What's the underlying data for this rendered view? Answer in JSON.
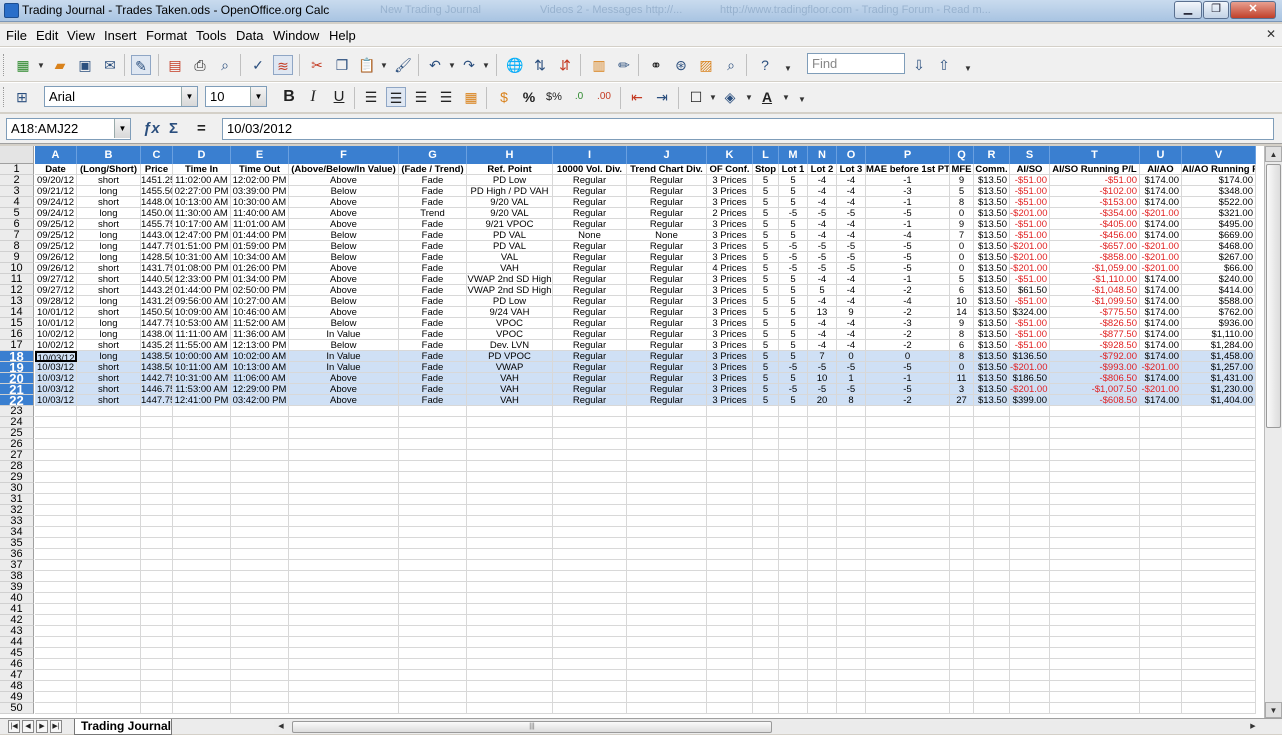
{
  "window": {
    "title": "Trading Journal - Trades Taken.ods - OpenOffice.org Calc",
    "background_ghost_text": [
      "New Trading Journal",
      "Videos 2 - Messages http://...",
      "http://www.tradingfloor.com - Trading Forum - Read m..."
    ]
  },
  "menu": [
    "File",
    "Edit",
    "View",
    "Insert",
    "Format",
    "Tools",
    "Data",
    "Window",
    "Help"
  ],
  "toolbar": {
    "find_placeholder": "Find",
    "font_name": "Arial",
    "font_size": "10"
  },
  "formula_bar": {
    "name_box": "A18:AMJ22",
    "fx_icon": "function-wizard-icon",
    "sum_icon": "sigma-icon",
    "equals": "=",
    "content": "10/03/2012"
  },
  "columns": [
    "A",
    "B",
    "C",
    "D",
    "E",
    "F",
    "G",
    "H",
    "I",
    "J",
    "K",
    "L",
    "M",
    "N",
    "O",
    "P",
    "Q",
    "R",
    "S",
    "T",
    "U",
    "V"
  ],
  "headers": [
    "Date",
    "(Long/Short)",
    "Price",
    "Time In",
    "Time Out",
    "(Above/Below/In Value)",
    "(Fade / Trend)",
    "Ref. Point",
    "10000 Vol. Div.",
    "Trend Chart Div.",
    "OF Conf.",
    "Stop",
    "Lot 1",
    "Lot 2",
    "Lot 3",
    "MAE before 1st PT",
    "MFE",
    "Comm.",
    "AI/SO",
    "AI/SO Running P/L",
    "AI/AO",
    "AI/AO Running P/L"
  ],
  "rows": [
    [
      "09/20/12",
      "short",
      "1451.25",
      "11:02:00 AM",
      "12:02:00 PM",
      "Above",
      "Fade",
      "PD Low",
      "Regular",
      "Regular",
      "3 Prices",
      "5",
      "5",
      "-4",
      "-4",
      "-1",
      "9",
      "$13.50",
      "-$51.00",
      "-$51.00",
      "$174.00",
      "$174.00"
    ],
    [
      "09/21/12",
      "long",
      "1455.50",
      "02:27:00 PM",
      "03:39:00 PM",
      "Below",
      "Fade",
      "PD High / PD VAH",
      "Regular",
      "Regular",
      "3 Prices",
      "5",
      "5",
      "-4",
      "-4",
      "-3",
      "5",
      "$13.50",
      "-$51.00",
      "-$102.00",
      "$174.00",
      "$348.00"
    ],
    [
      "09/24/12",
      "short",
      "1448.00",
      "10:13:00 AM",
      "10:30:00 AM",
      "Above",
      "Fade",
      "9/20 VAL",
      "Regular",
      "Regular",
      "3 Prices",
      "5",
      "5",
      "-4",
      "-4",
      "-1",
      "8",
      "$13.50",
      "-$51.00",
      "-$153.00",
      "$174.00",
      "$522.00"
    ],
    [
      "09/24/12",
      "long",
      "1450.00",
      "11:30:00 AM",
      "11:40:00 AM",
      "Above",
      "Trend",
      "9/20 VAL",
      "Regular",
      "Regular",
      "2 Prices",
      "5",
      "-5",
      "-5",
      "-5",
      "-5",
      "0",
      "$13.50",
      "-$201.00",
      "-$354.00",
      "-$201.00",
      "$321.00"
    ],
    [
      "09/25/12",
      "short",
      "1455.75",
      "10:17:00 AM",
      "11:01:00 AM",
      "Above",
      "Fade",
      "9/21 VPOC",
      "Regular",
      "Regular",
      "3 Prices",
      "5",
      "5",
      "-4",
      "-4",
      "-1",
      "9",
      "$13.50",
      "-$51.00",
      "-$405.00",
      "$174.00",
      "$495.00"
    ],
    [
      "09/25/12",
      "long",
      "1443.00",
      "12:47:00 PM",
      "01:44:00 PM",
      "Below",
      "Fade",
      "PD VAL",
      "None",
      "None",
      "3 Prices",
      "5",
      "5",
      "-4",
      "-4",
      "-4",
      "7",
      "$13.50",
      "-$51.00",
      "-$456.00",
      "$174.00",
      "$669.00"
    ],
    [
      "09/25/12",
      "long",
      "1447.75",
      "01:51:00 PM",
      "01:59:00 PM",
      "Below",
      "Fade",
      "PD VAL",
      "Regular",
      "Regular",
      "3 Prices",
      "5",
      "-5",
      "-5",
      "-5",
      "-5",
      "0",
      "$13.50",
      "-$201.00",
      "-$657.00",
      "-$201.00",
      "$468.00"
    ],
    [
      "09/26/12",
      "long",
      "1428.50",
      "10:31:00 AM",
      "10:34:00 AM",
      "Below",
      "Fade",
      "VAL",
      "Regular",
      "Regular",
      "3 Prices",
      "5",
      "-5",
      "-5",
      "-5",
      "-5",
      "0",
      "$13.50",
      "-$201.00",
      "-$858.00",
      "-$201.00",
      "$267.00"
    ],
    [
      "09/26/12",
      "short",
      "1431.75",
      "01:08:00 PM",
      "01:26:00 PM",
      "Above",
      "Fade",
      "VAH",
      "Regular",
      "Regular",
      "4 Prices",
      "5",
      "-5",
      "-5",
      "-5",
      "-5",
      "0",
      "$13.50",
      "-$201.00",
      "-$1,059.00",
      "-$201.00",
      "$66.00"
    ],
    [
      "09/27/12",
      "short",
      "1440.50",
      "12:33:00 PM",
      "01:34:00 PM",
      "Above",
      "Fade",
      "VWAP 2nd SD High",
      "Regular",
      "Regular",
      "3 Prices",
      "5",
      "5",
      "-4",
      "-4",
      "-1",
      "5",
      "$13.50",
      "-$51.00",
      "-$1,110.00",
      "$174.00",
      "$240.00"
    ],
    [
      "09/27/12",
      "short",
      "1443.25",
      "01:44:00 PM",
      "02:50:00 PM",
      "Above",
      "Fade",
      "VWAP 2nd SD High",
      "Regular",
      "Regular",
      "3 Prices",
      "5",
      "5",
      "5",
      "-4",
      "-2",
      "6",
      "$13.50",
      "$61.50",
      "-$1,048.50",
      "$174.00",
      "$414.00"
    ],
    [
      "09/28/12",
      "long",
      "1431.25",
      "09:56:00 AM",
      "10:27:00 AM",
      "Below",
      "Fade",
      "PD Low",
      "Regular",
      "Regular",
      "3 Prices",
      "5",
      "5",
      "-4",
      "-4",
      "-4",
      "10",
      "$13.50",
      "-$51.00",
      "-$1,099.50",
      "$174.00",
      "$588.00"
    ],
    [
      "10/01/12",
      "short",
      "1450.50",
      "10:09:00 AM",
      "10:46:00 AM",
      "Above",
      "Fade",
      "9/24 VAH",
      "Regular",
      "Regular",
      "3 Prices",
      "5",
      "5",
      "13",
      "9",
      "-2",
      "14",
      "$13.50",
      "$324.00",
      "-$775.50",
      "$174.00",
      "$762.00"
    ],
    [
      "10/01/12",
      "long",
      "1447.75",
      "10:53:00 AM",
      "11:52:00 AM",
      "Below",
      "Fade",
      "VPOC",
      "Regular",
      "Regular",
      "3 Prices",
      "5",
      "5",
      "-4",
      "-4",
      "-3",
      "9",
      "$13.50",
      "-$51.00",
      "-$826.50",
      "$174.00",
      "$936.00"
    ],
    [
      "10/02/12",
      "long",
      "1438.00",
      "11:11:00 AM",
      "11:36:00 AM",
      "In Value",
      "Fade",
      "VPOC",
      "Regular",
      "Regular",
      "3 Prices",
      "5",
      "5",
      "-4",
      "-4",
      "-2",
      "8",
      "$13.50",
      "-$51.00",
      "-$877.50",
      "$174.00",
      "$1,110.00"
    ],
    [
      "10/02/12",
      "short",
      "1435.25",
      "11:55:00 AM",
      "12:13:00 PM",
      "Below",
      "Fade",
      "Dev. LVN",
      "Regular",
      "Regular",
      "3 Prices",
      "5",
      "5",
      "-4",
      "-4",
      "-2",
      "6",
      "$13.50",
      "-$51.00",
      "-$928.50",
      "$174.00",
      "$1,284.00"
    ],
    [
      "10/03/12",
      "long",
      "1438.50",
      "10:00:00 AM",
      "10:02:00 AM",
      "In Value",
      "Fade",
      "PD VPOC",
      "Regular",
      "Regular",
      "3 Prices",
      "5",
      "5",
      "7",
      "0",
      "0",
      "8",
      "$13.50",
      "$136.50",
      "-$792.00",
      "$174.00",
      "$1,458.00"
    ],
    [
      "10/03/12",
      "short",
      "1438.50",
      "10:11:00 AM",
      "10:13:00 AM",
      "In Value",
      "Fade",
      "VWAP",
      "Regular",
      "Regular",
      "3 Prices",
      "5",
      "-5",
      "-5",
      "-5",
      "-5",
      "0",
      "$13.50",
      "-$201.00",
      "-$993.00",
      "-$201.00",
      "$1,257.00"
    ],
    [
      "10/03/12",
      "short",
      "1442.75",
      "10:31:00 AM",
      "11:06:00 AM",
      "Above",
      "Fade",
      "VAH",
      "Regular",
      "Regular",
      "3 Prices",
      "5",
      "5",
      "10",
      "1",
      "-1",
      "11",
      "$13.50",
      "$186.50",
      "-$806.50",
      "$174.00",
      "$1,431.00"
    ],
    [
      "10/03/12",
      "short",
      "1446.75",
      "11:53:00 AM",
      "12:29:00 PM",
      "Above",
      "Fade",
      "VAH",
      "Regular",
      "Regular",
      "3 Prices",
      "5",
      "-5",
      "-5",
      "-5",
      "-5",
      "3",
      "$13.50",
      "-$201.00",
      "-$1,007.50",
      "-$201.00",
      "$1,230.00"
    ],
    [
      "10/03/12",
      "short",
      "1447.75",
      "12:41:00 PM",
      "03:42:00 PM",
      "Above",
      "Fade",
      "VAH",
      "Regular",
      "Regular",
      "3 Prices",
      "5",
      "5",
      "20",
      "8",
      "-2",
      "27",
      "$13.50",
      "$399.00",
      "-$608.50",
      "$174.00",
      "$1,404.00"
    ]
  ],
  "row_numbers": [
    1,
    2,
    3,
    4,
    5,
    6,
    7,
    8,
    9,
    10,
    11,
    12,
    13,
    14,
    15,
    16,
    17,
    18,
    19,
    20,
    21,
    22,
    23,
    24,
    25,
    26,
    27,
    28,
    29,
    30,
    31,
    32,
    33,
    34,
    35,
    36,
    37,
    38,
    39,
    40,
    41,
    42,
    43,
    44,
    45,
    46,
    47,
    48,
    49,
    50
  ],
  "selected_rows": [
    18,
    19,
    20,
    21,
    22
  ],
  "sheet_tab": "Trading Journal",
  "colors": {
    "header_blue": "#3a7fd0",
    "selection": "#cfe0f5",
    "negative": "#e02020"
  }
}
